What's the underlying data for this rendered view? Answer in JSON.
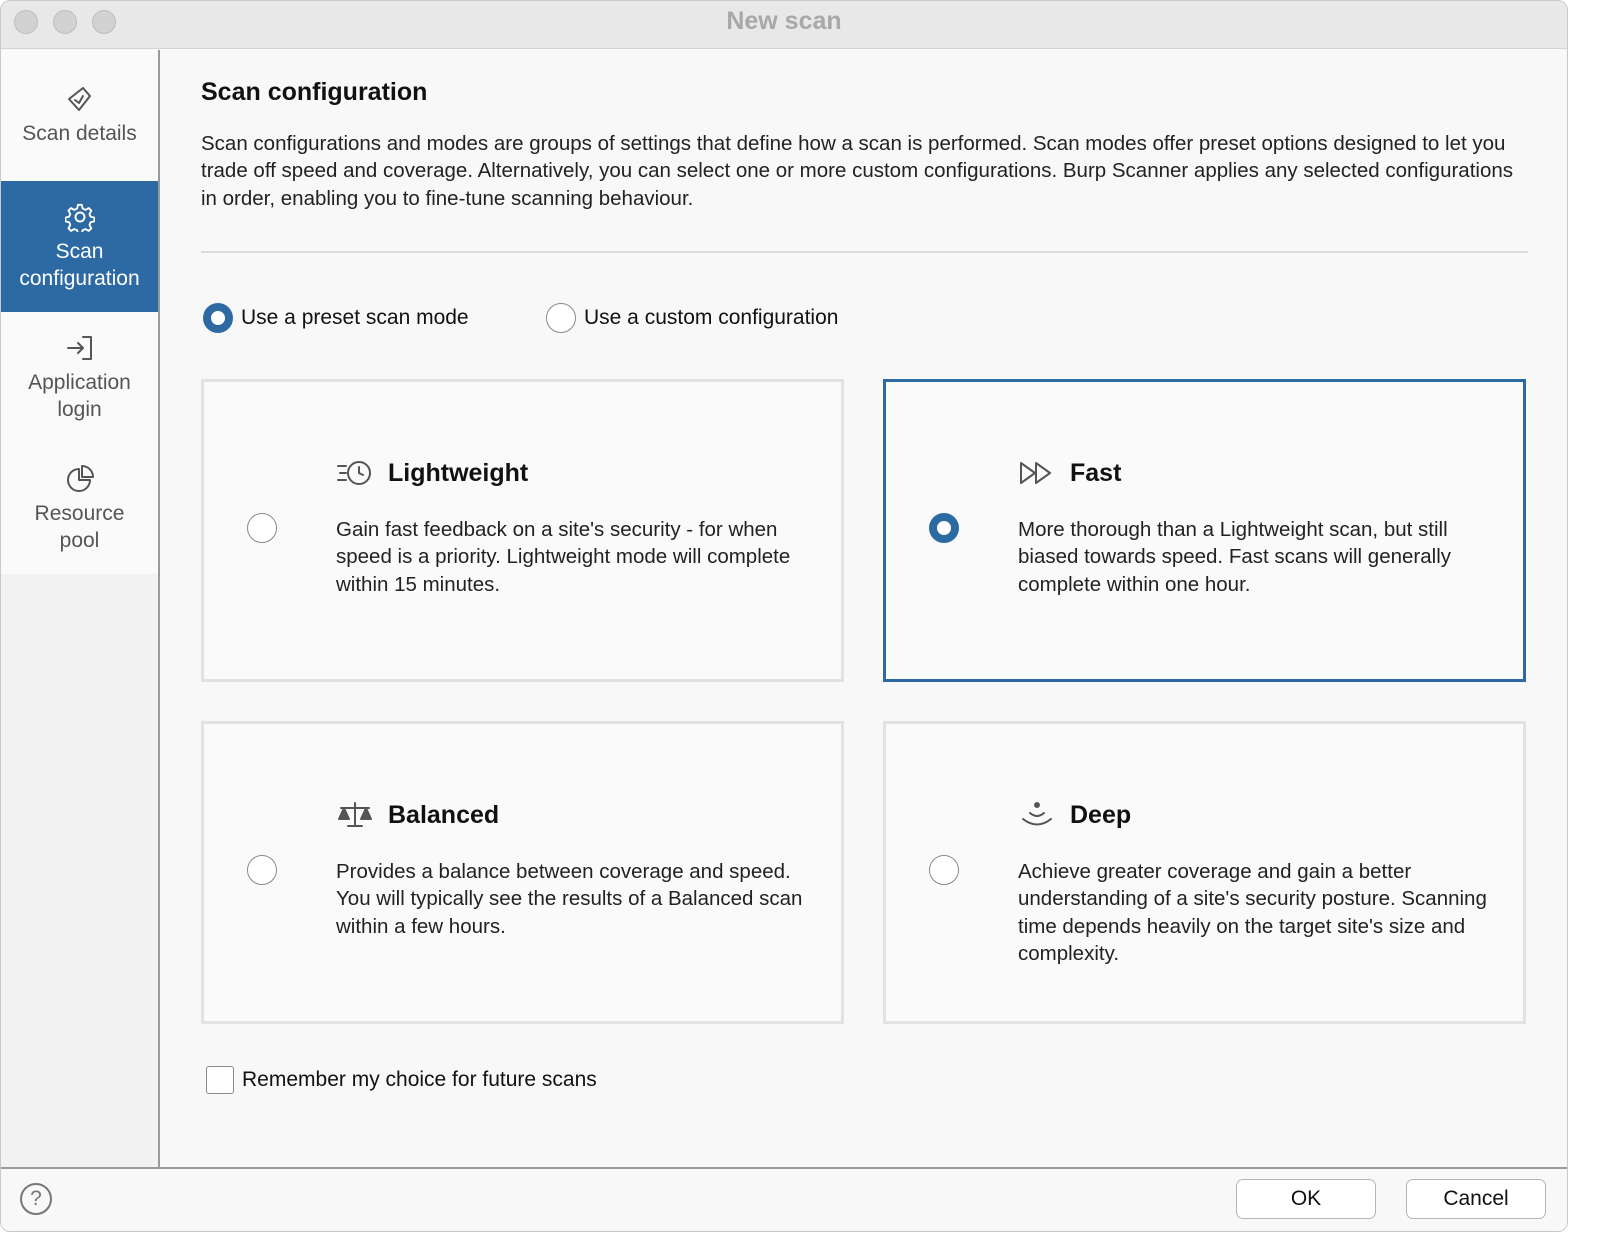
{
  "window": {
    "title": "New scan"
  },
  "sidebar": {
    "items": [
      {
        "label_line1": "Scan details",
        "label_line2": "",
        "icon": "scan-details-icon",
        "active": false
      },
      {
        "label_line1": "Scan",
        "label_line2": "configuration",
        "icon": "gear-icon",
        "active": true
      },
      {
        "label_line1": "Application",
        "label_line2": "login",
        "icon": "login-arrow-icon",
        "active": false
      },
      {
        "label_line1": "Resource",
        "label_line2": "pool",
        "icon": "pie-chart-icon",
        "active": false
      }
    ]
  },
  "main": {
    "heading": "Scan configuration",
    "description": "Scan configurations and modes are groups of settings that define how a scan is performed. Scan modes offer preset options designed to let you trade off speed and coverage. Alternatively, you can select one or more custom configurations. Burp Scanner applies any selected configurations in order, enabling you to fine-tune scanning behaviour.",
    "mode_options": {
      "preset": {
        "label": "Use a preset scan mode",
        "selected": true
      },
      "custom": {
        "label": "Use a custom configuration",
        "selected": false
      }
    },
    "cards": [
      {
        "title": "Lightweight",
        "icon": "timer-icon",
        "selected": false,
        "description": "Gain fast feedback on a site's security - for when speed is a priority. Lightweight mode will complete within 15 minutes."
      },
      {
        "title": "Fast",
        "icon": "fast-forward-icon",
        "selected": true,
        "description": "More thorough than a Lightweight scan, but still biased towards speed. Fast scans will generally complete within one hour."
      },
      {
        "title": "Balanced",
        "icon": "balance-scale-icon",
        "selected": false,
        "description": "Provides a balance between coverage and speed. You will typically see the results of a Balanced scan within a few hours."
      },
      {
        "title": "Deep",
        "icon": "signal-waves-icon",
        "selected": false,
        "description": "Achieve greater coverage and gain a better understanding of a site's security posture. Scanning time depends heavily on the target site's size and complexity."
      }
    ],
    "remember_label": "Remember my choice for future scans",
    "remember_checked": false
  },
  "footer": {
    "help_symbol": "?",
    "ok_label": "OK",
    "cancel_label": "Cancel"
  },
  "colors": {
    "accent": "#2d6aa3",
    "card_border": "#e2e2e2",
    "title_gray": "#a8a8a8"
  }
}
